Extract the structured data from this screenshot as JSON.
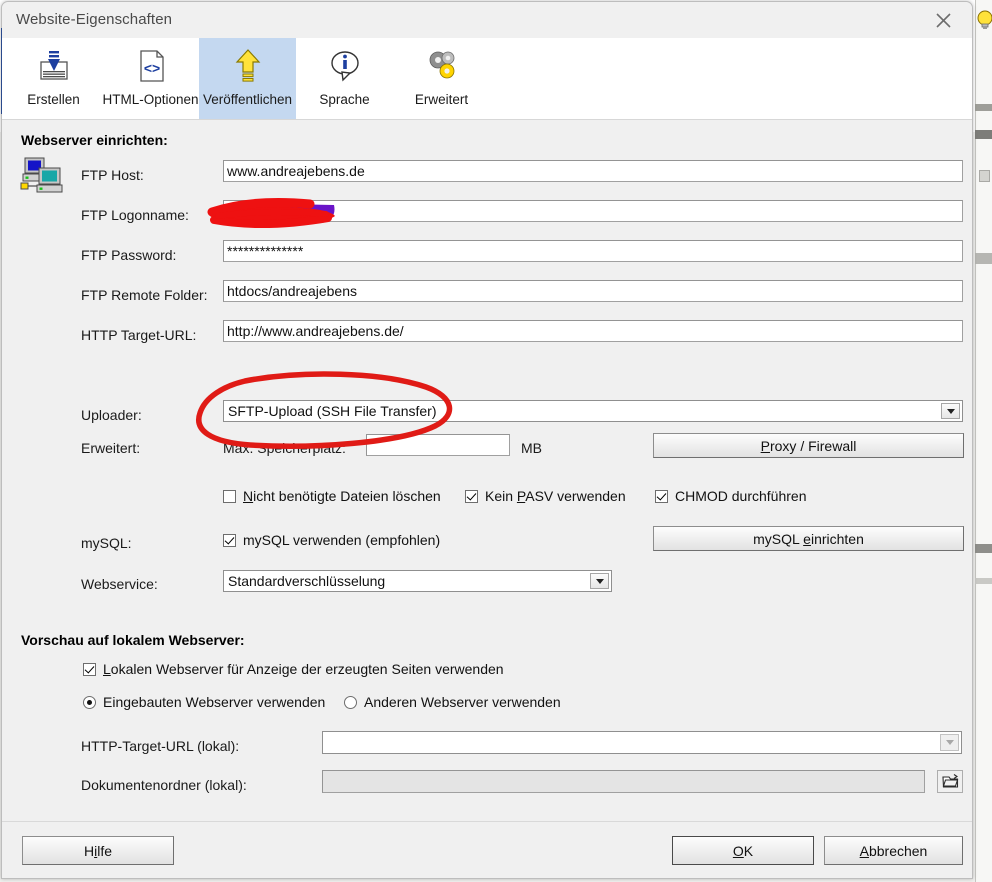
{
  "window": {
    "title": "Website-Eigenschaften",
    "close_icon": "close-icon"
  },
  "toolbar": {
    "items": [
      {
        "label": "Erstellen",
        "icon": "download-tray-icon",
        "selected": false
      },
      {
        "label": "HTML-Optionen",
        "icon": "code-document-icon",
        "selected": false
      },
      {
        "label": "Veröffentlichen",
        "icon": "upload-arrow-icon",
        "selected": true
      },
      {
        "label": "Sprache",
        "icon": "info-bubble-icon",
        "selected": false
      },
      {
        "label": "Erweitert",
        "icon": "gears-icon",
        "selected": false
      }
    ]
  },
  "webserver_section": {
    "heading": "Webserver einrichten:",
    "server_icon": "two-computers-icon",
    "fields": {
      "ftp_host": {
        "label": "FTP Host:",
        "value": "www.andreajebens.de"
      },
      "ftp_logon": {
        "label": "FTP Logonname:",
        "value": "",
        "redacted": true
      },
      "ftp_password": {
        "label": "FTP Password:",
        "value": "**************"
      },
      "ftp_remote_folder": {
        "label": "FTP Remote Folder:",
        "value": "htdocs/andreajebens"
      },
      "http_target_url": {
        "label": "HTTP Target-URL:",
        "value": "http://www.andreajebens.de/"
      }
    },
    "uploader": {
      "label": "Uploader:",
      "value": "SFTP-Upload (SSH File Transfer)",
      "annotated": true
    },
    "erweitert": {
      "label": "Erweitert:",
      "max_space_label": "Max. Speicherplatz:",
      "max_space_value": "",
      "unit": "MB"
    },
    "checkboxes": {
      "delete_unneeded": {
        "label": "Nicht benötigte Dateien löschen",
        "accel": "N",
        "checked": false
      },
      "no_pasv": {
        "label": "Kein PASV verwenden",
        "accel": "P",
        "checked": true
      },
      "chmod": {
        "label": "CHMOD durchführen",
        "accel": "",
        "checked": true
      },
      "mysql_use": {
        "label": "mySQL verwenden (empfohlen)",
        "accel": "",
        "checked": true
      }
    },
    "mysql": {
      "label": "mySQL:"
    },
    "webservice": {
      "label": "Webservice:",
      "value": "Standardverschlüsselung"
    },
    "buttons": {
      "proxy_firewall": {
        "label": "Proxy / Firewall",
        "accel": "P"
      },
      "mysql_setup": {
        "label": "mySQL einrichten",
        "accel": "e"
      }
    }
  },
  "preview_section": {
    "heading": "Vorschau auf lokalem Webserver:",
    "use_local": {
      "label": "Lokalen Webserver für Anzeige der erzeugten Seiten verwenden",
      "accel": "L",
      "checked": true
    },
    "radios": [
      {
        "label": "Eingebauten Webserver verwenden",
        "selected": true
      },
      {
        "label": "Anderen Webserver verwenden",
        "selected": false
      }
    ],
    "http_target_local": {
      "label": "HTTP-Target-URL (lokal):",
      "value": ""
    },
    "doc_folder_local": {
      "label": "Dokumentenordner (lokal):",
      "value": "",
      "browse_icon": "open-folder-icon"
    }
  },
  "footer": {
    "help": {
      "label": "Hilfe",
      "accel": "i"
    },
    "ok": {
      "label": "OK",
      "accel": "O"
    },
    "cancel": {
      "label": "Abbrechen",
      "accel": "A"
    }
  },
  "annotations": {
    "redaction_color": "#ee1111",
    "redaction_under_color": "#6a14c8",
    "ellipse_color": "#e01b16"
  },
  "background": {
    "bulb_icon": "lightbulb-icon"
  }
}
